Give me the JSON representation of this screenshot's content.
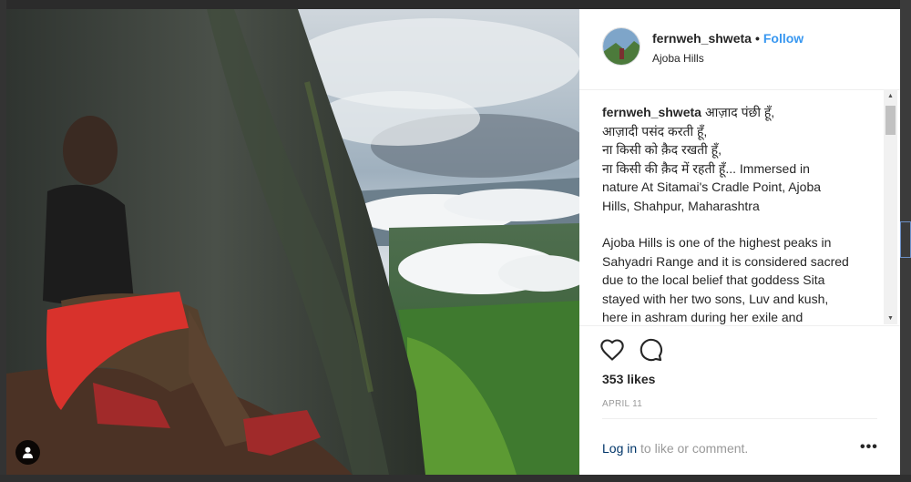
{
  "post": {
    "username": "fernweh_shweta",
    "separator": "•",
    "follow_label": "Follow",
    "location": "Ajoba Hills"
  },
  "caption": {
    "author": "fernweh_shweta",
    "line1": "आज़ाद पंछी हूँ,",
    "line2": "आज़ादी पसंद करती हूँ,",
    "line3": "ना किसी को क़ैद रखती हूँ,",
    "line4": "ना किसी की क़ैद में रहती हूँ... Immersed in",
    "line5": "nature At Sitamai's Cradle Point, Ajoba",
    "line6": "Hills, Shahpur, Maharashtra",
    "para2_line1": "Ajoba Hills is one of the highest peaks in",
    "para2_line2": "Sahyadri Range and it is considered sacred",
    "para2_line3": "due to the local belief that goddess Sita",
    "para2_line4": "stayed with her two sons, Luv and kush,",
    "para2_line5": "here in ashram during her exile and"
  },
  "engagement": {
    "likes": "353 likes",
    "date": "APRIL 11"
  },
  "footer": {
    "login_label": "Log in",
    "rest_label": " to like or comment.",
    "more_label": "•••"
  },
  "icons": {
    "like": "heart-icon",
    "comment": "comment-icon",
    "user_tag": "user-icon"
  },
  "colors": {
    "follow": "#3897f0",
    "login": "#003569",
    "muted": "#999999",
    "text": "#262626"
  }
}
